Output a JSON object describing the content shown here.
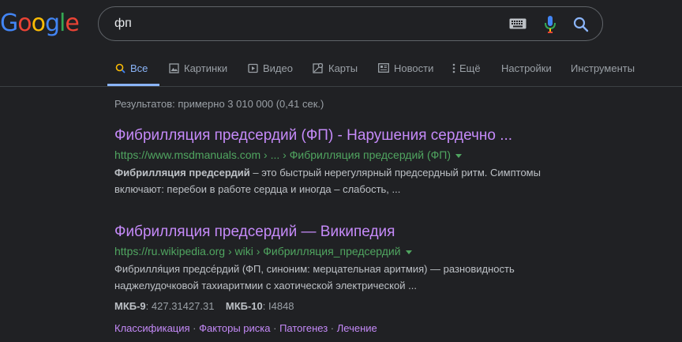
{
  "logo": {
    "letters": [
      "G",
      "o",
      "o",
      "g",
      "l",
      "e"
    ],
    "colors": [
      "#4285f4",
      "#ea4335",
      "#fbbc05",
      "#4285f4",
      "#34a853",
      "#ea4335"
    ]
  },
  "search": {
    "query": "фп",
    "icons": [
      "keyboard-icon",
      "mic-icon",
      "search-icon"
    ]
  },
  "tabs": [
    {
      "label": "Все",
      "icon": "search-icon",
      "active": true
    },
    {
      "label": "Картинки",
      "icon": "image-icon"
    },
    {
      "label": "Видео",
      "icon": "video-icon"
    },
    {
      "label": "Карты",
      "icon": "map-icon"
    },
    {
      "label": "Новости",
      "icon": "news-icon"
    },
    {
      "label": "Ещё",
      "icon": "more-vert-icon"
    },
    {
      "label": "Настройки"
    },
    {
      "label": "Инструменты"
    }
  ],
  "results_count": "Результатов: примерно 3 010 000 (0,41 сек.)",
  "results": [
    {
      "title": "Фибрилляция предсердий (ФП) - Нарушения сердечно ...",
      "url": "https://www.msdmanuals.com › ... › Фибрилляция предсердий (ФП)",
      "snippet_bold": "Фибрилляция предсердий",
      "snippet_rest": " – это быстрый нерегулярный предсердный ритм. Симптомы включают: перебои в работе сердца и иногда – слабость, ..."
    },
    {
      "title": "Фибрилляция предсердий — Википедия",
      "url": "https://ru.wikipedia.org › wiki › Фибрилляция_предсердий",
      "snippet_rest": "Фибрилля́ция предсе́рдий (ФП, синоним: мерцательная аритмия) — разновидность наджелудочковой тахиаритмии с хаотической электрической ...",
      "meta": [
        {
          "key": "МКБ-9",
          "value": ": 427.31427.31"
        },
        {
          "key": "МКБ-10",
          "value": ": I4848"
        }
      ],
      "sitelinks": [
        "Классификация",
        "Факторы риска",
        "Патогенез",
        "Лечение"
      ]
    }
  ],
  "colors": {
    "background": "#202124",
    "link_visited": "#c58af9",
    "url_green": "#50a560",
    "active_tab": "#8ab4f8"
  }
}
